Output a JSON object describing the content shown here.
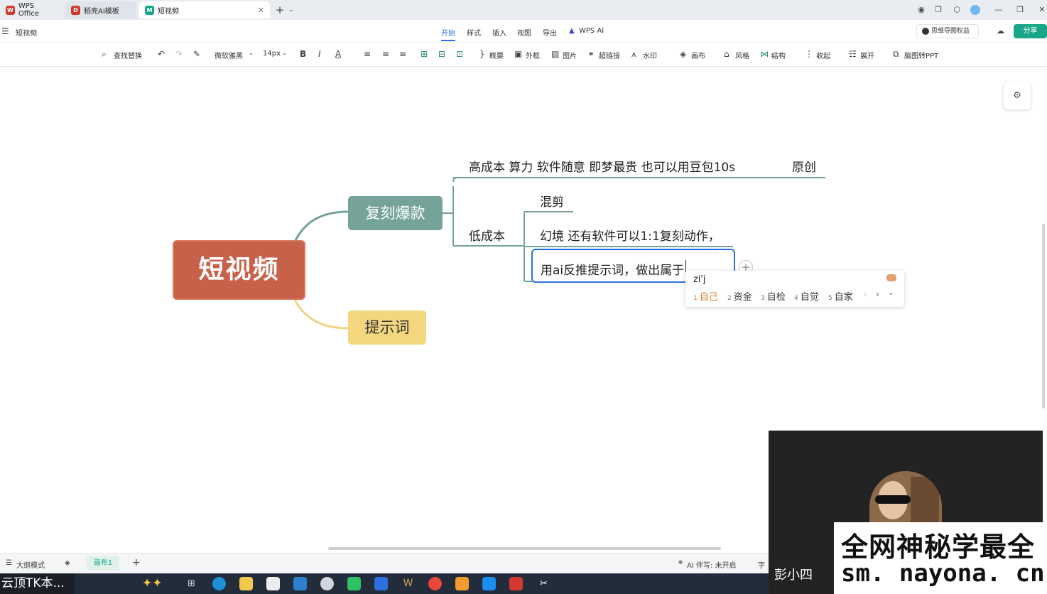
{
  "titlebar": {
    "tabs": [
      {
        "label": "WPS Office",
        "color": "#d23a2f"
      },
      {
        "label": "稻壳AI模板",
        "color": "#d23a2f"
      },
      {
        "label": "短视频",
        "color": "#18a689"
      }
    ],
    "new_tab_icon": "plus-icon"
  },
  "menu": {
    "doc_title": "短视频",
    "items": [
      "开始",
      "样式",
      "插入",
      "视图",
      "导出",
      "WPS AI"
    ],
    "rights_label": "思维导图权益",
    "share_label": "分享"
  },
  "toolbar": {
    "find_replace": "查找替换",
    "font": "微软雅黑",
    "font_size": "14px",
    "summary": "概要",
    "frame": "外框",
    "image": "图片",
    "hyperlink": "超链接",
    "watermark": "水印",
    "canvas": "画布",
    "style": "风格",
    "structure": "结构",
    "collapse": "收起",
    "expand": "展开",
    "to_ppt": "脑图转PPT"
  },
  "mindmap": {
    "root": "短视频",
    "branch1": "复刻爆款",
    "branch2": "提示词",
    "high_cost": "高成本  算力  软件随意  即梦最贵  也可以用豆包10s",
    "original": "原创",
    "low_cost": "低成本",
    "mix_cut": "混剪",
    "illusion": "幻境  还有软件可以1:1复刻动作，",
    "editing_text": "用ai反推提示词，做出属于"
  },
  "ime": {
    "pinyin": "zi'j",
    "candidates": [
      {
        "num": "1",
        "text": "自己"
      },
      {
        "num": "2",
        "text": "资金"
      },
      {
        "num": "3",
        "text": "自检"
      },
      {
        "num": "4",
        "text": "自觉"
      },
      {
        "num": "5",
        "text": "自家"
      }
    ]
  },
  "statusbar": {
    "outline_mode": "大纲模式",
    "canvas_tab": "画布1",
    "ai_status": "AI 伴写: 未开启",
    "trailing": "字"
  },
  "taskbar": {
    "left_label": "云顶TK本..."
  },
  "overlay": {
    "presenter": "彭小四",
    "banner_line1": "全网神秘学最全",
    "banner_line2": "sm. nayona. cn"
  }
}
